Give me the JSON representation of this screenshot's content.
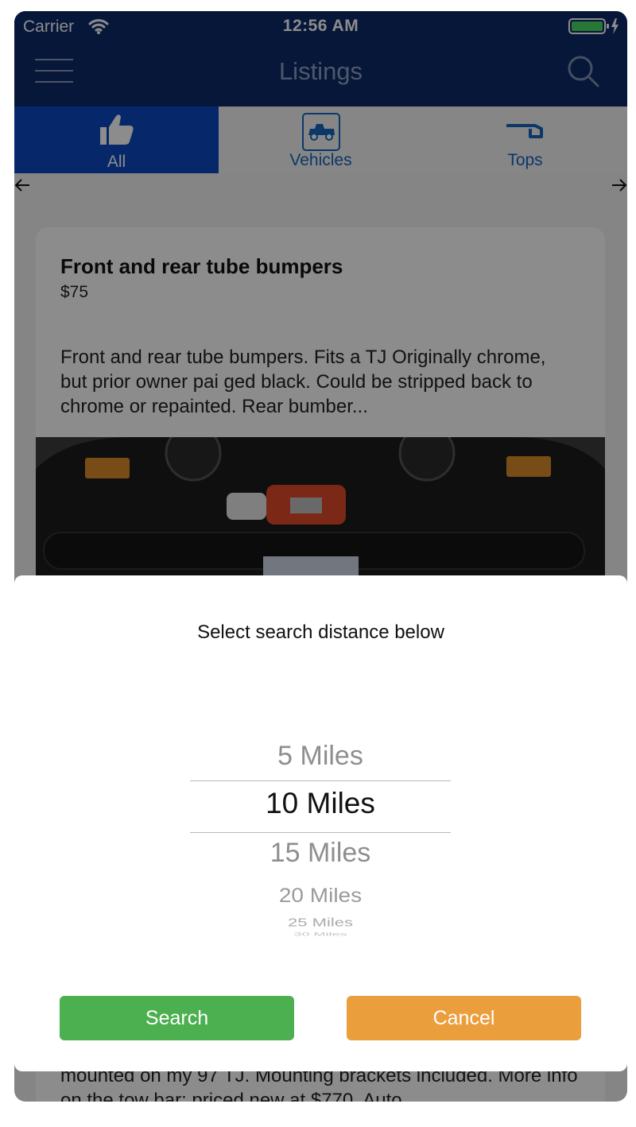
{
  "status_bar": {
    "carrier": "Carrier",
    "time": "12:56 AM"
  },
  "nav": {
    "title": "Listings"
  },
  "tabs": [
    {
      "label": "All",
      "icon": "thumbs-up-icon",
      "active": true
    },
    {
      "label": "Vehicles",
      "icon": "jeep-icon",
      "active": false
    },
    {
      "label": "Tops",
      "icon": "top-icon",
      "active": false
    }
  ],
  "listing": {
    "title": "Front and rear tube bumpers",
    "price": "$75",
    "description": "Front and rear tube bumpers.  Fits a TJ Originally chrome, but prior owner pai ged black.  Could be stripped back to chrome or repainted. Rear bumber...",
    "description_more": "mounted on my 97 TJ.  Mounting brackets included. More info on the tow bar:  priced new at $770. Auto"
  },
  "modal": {
    "title": "Select search distance below",
    "options": [
      "5 Miles",
      "10 Miles",
      "15 Miles",
      "20 Miles",
      "25 Miles",
      "30 Miles"
    ],
    "selected": "10 Miles",
    "search_label": "Search",
    "cancel_label": "Cancel"
  },
  "colors": {
    "nav_bg": "#0d2b6b",
    "active_tab": "#0d47c4",
    "search_button": "#4caf50",
    "cancel_button": "#eb9e3c"
  }
}
